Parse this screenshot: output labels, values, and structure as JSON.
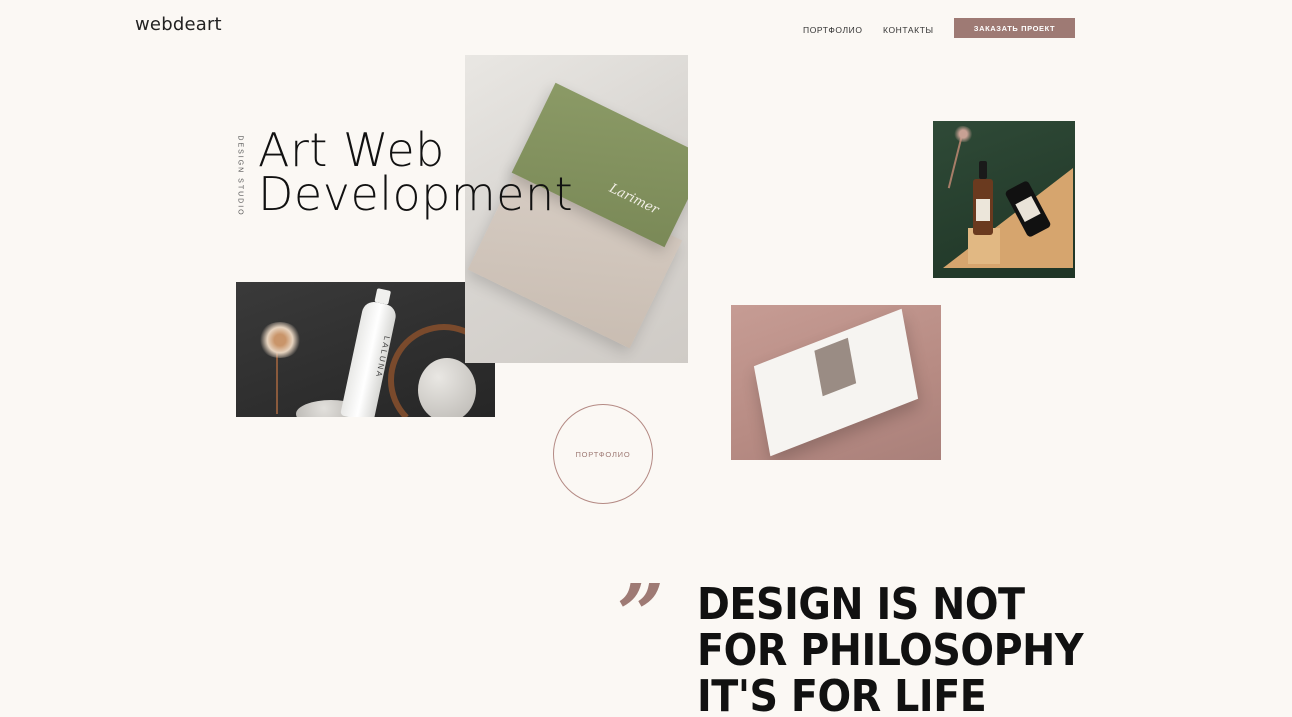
{
  "header": {
    "logo": "webdeart",
    "nav": [
      "ПОРТФОЛИО",
      "КОНТАКТЫ"
    ],
    "cta": "ЗАКАЗАТЬ ПРОЕКТ"
  },
  "hero": {
    "side_label": "DESIGN STUDIO",
    "title_line1": "Art Web",
    "title_line2": "Development",
    "portfolio_button": "ПОРТФОЛИО",
    "card_brand": "Larimer",
    "bottle_label": "LALUNA"
  },
  "quote": {
    "mark": "”",
    "line1": "DESIGN IS NOT",
    "line2": "FOR PHILOSOPHY",
    "line3": "IT'S FOR LIFE"
  },
  "colors": {
    "background": "#fbf8f4",
    "accent": "#9e7a74",
    "text": "#111111"
  }
}
